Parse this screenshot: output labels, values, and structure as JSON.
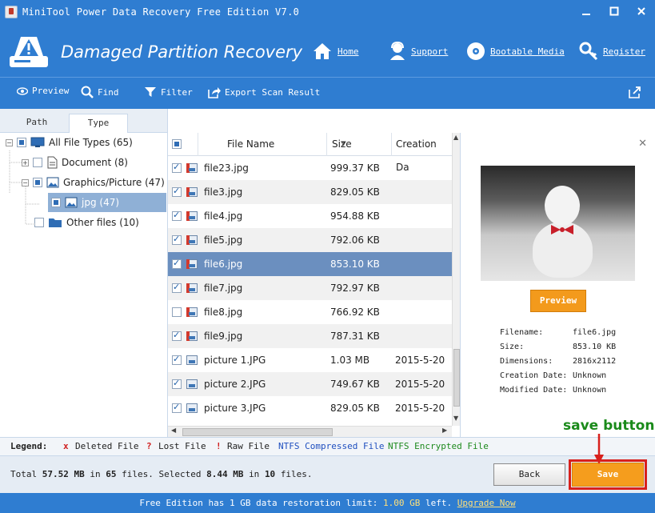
{
  "window": {
    "title": "MiniTool Power Data Recovery Free Edition V7.0"
  },
  "header": {
    "title": "Damaged Partition Recovery",
    "nav": [
      {
        "label": "Home",
        "icon": "home-icon"
      },
      {
        "label": "Support",
        "icon": "support-icon"
      },
      {
        "label": "Bootable Media",
        "icon": "disc-icon"
      },
      {
        "label": "Register",
        "icon": "key-icon"
      }
    ]
  },
  "toolbar": {
    "preview": "Preview",
    "find": "Find",
    "filter": "Filter",
    "export": "Export Scan Result"
  },
  "tabs": {
    "path": "Path",
    "type": "Type"
  },
  "tree": {
    "all": "All File Types (65)",
    "document": "Document (8)",
    "graphics": "Graphics/Picture (47)",
    "jpg": "jpg (47)",
    "other": "Other files (10)"
  },
  "columns": {
    "name": "File Name",
    "size": "Size",
    "date": "Creation Da"
  },
  "files": [
    {
      "name": "file23.jpg",
      "size": "999.37 KB",
      "date": "",
      "checked": true
    },
    {
      "name": "file3.jpg",
      "size": "829.05 KB",
      "date": "",
      "checked": true
    },
    {
      "name": "file4.jpg",
      "size": "954.88 KB",
      "date": "",
      "checked": true
    },
    {
      "name": "file5.jpg",
      "size": "792.06 KB",
      "date": "",
      "checked": true
    },
    {
      "name": "file6.jpg",
      "size": "853.10 KB",
      "date": "",
      "checked": true
    },
    {
      "name": "file7.jpg",
      "size": "792.97 KB",
      "date": "",
      "checked": true
    },
    {
      "name": "file8.jpg",
      "size": "766.92 KB",
      "date": "",
      "checked": false
    },
    {
      "name": "file9.jpg",
      "size": "787.31 KB",
      "date": "",
      "checked": true
    },
    {
      "name": "picture 1.JPG",
      "size": "1.03 MB",
      "date": "2015-5-20",
      "checked": true
    },
    {
      "name": "picture 2.JPG",
      "size": "749.67 KB",
      "date": "2015-5-20",
      "checked": true
    },
    {
      "name": "picture 3.JPG",
      "size": "829.05 KB",
      "date": "2015-5-20",
      "checked": true
    }
  ],
  "preview": {
    "button": "Preview",
    "filename_label": "Filename:",
    "filename": "file6.jpg",
    "size_label": "Size:",
    "size": "853.10 KB",
    "dimensions_label": "Dimensions:",
    "dimensions": "2816x2112",
    "creation_label": "Creation Date:",
    "creation": "Unknown",
    "modified_label": "Modified Date:",
    "modified": "Unknown"
  },
  "legend": {
    "title": "Legend:",
    "deleted_mark": "x",
    "deleted": "Deleted File",
    "lost_mark": "?",
    "lost": "Lost File",
    "raw_mark": "!",
    "raw": "Raw File",
    "compressed": "NTFS Compressed File",
    "encrypted": "NTFS Encrypted File"
  },
  "status": {
    "total_prefix": "Total",
    "total_size": "57.52 MB",
    "in": "in",
    "total_files": "65",
    "files_selected": "files. Selected",
    "selected_size": "8.44 MB",
    "selected_files": "10",
    "files_end": "files.",
    "back": "Back",
    "save": "Save"
  },
  "footer": {
    "prefix": "Free Edition has 1 GB data restoration limit:",
    "remaining": "1.00 GB",
    "suffix": "left.",
    "upgrade": "Upgrade Now"
  },
  "annotation": "save button",
  "colors": {
    "brand_blue": "#2f7dd1",
    "save_orange": "#f59d1d",
    "annotation_green": "#1a8a1a",
    "highlight_red": "#d8201c"
  }
}
